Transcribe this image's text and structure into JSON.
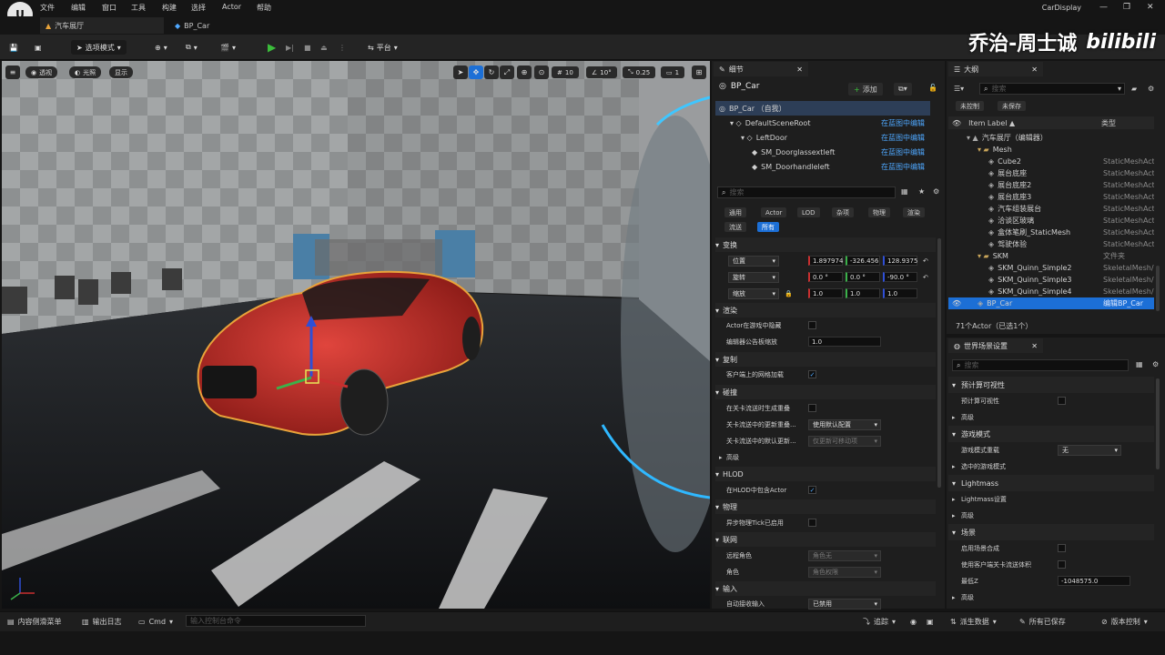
{
  "menu": [
    "文件",
    "编辑",
    "窗口",
    "工具",
    "构建",
    "选择",
    "Actor",
    "帮助"
  ],
  "window_title": "CarDisplay",
  "tabs": [
    "汽车展厅",
    "BP_Car"
  ],
  "toolbar": {
    "mode": "选项模式",
    "platform": "平台"
  },
  "watermark": "乔治-周士诚",
  "watermark_logo": "bilibili",
  "viewport": {
    "view_mode": "透视",
    "lighting": "光照",
    "show": "显示",
    "grid_snap": "10",
    "angle_snap": "10°",
    "scale_snap": "0.25",
    "cameras": "1"
  },
  "details": {
    "tab": "细节",
    "actor_name": "BP_Car",
    "add_label": "添加",
    "components": [
      {
        "label": "BP_Car （自我）",
        "link": "",
        "indent": 0
      },
      {
        "label": "DefaultSceneRoot",
        "link": "在蓝图中编辑",
        "indent": 1
      },
      {
        "label": "LeftDoor",
        "link": "在蓝图中编辑",
        "indent": 2
      },
      {
        "label": "SM_Doorglassextleft",
        "link": "在蓝图中编辑",
        "indent": 3
      },
      {
        "label": "SM_Doorhandleleft",
        "link": "在蓝图中编辑",
        "indent": 3
      }
    ],
    "search_placeholder": "搜索",
    "filters": [
      "通用",
      "Actor",
      "LOD",
      "杂项",
      "物理",
      "渲染",
      "流送",
      "所有"
    ],
    "sections": {
      "transform": "变换",
      "rendering": "渲染",
      "replication": "复制",
      "collision": "碰撞",
      "advanced": "高级",
      "hlod": "HLOD",
      "physics": "物理",
      "networking": "联网",
      "input": "输入"
    },
    "transform": {
      "location_label": "位置",
      "location": [
        "1.897974",
        "-326.456",
        "128.9375"
      ],
      "rotation_label": "旋转",
      "rotation": [
        "0.0 °",
        "0.0 °",
        "-90.0 °"
      ],
      "scale_label": "缩放",
      "scale": [
        "1.0",
        "1.0",
        "1.0"
      ]
    },
    "props": {
      "hidden_in_game": "Actor在游戏中隐藏",
      "billboard_scale": "编辑器公告板缩放",
      "billboard_scale_value": "1.0",
      "net_load_client": "客户端上的网格加载",
      "gen_overlap_level": "在关卡流送时生成重叠",
      "update_overlap_method": "关卡流送中的更新重叠...",
      "update_overlap_value": "使用默认配置",
      "default_update_overlap": "关卡流送中的默认更新...",
      "default_update_overlap_value": "仅更新可移动项",
      "include_in_hlod": "在HLOD中包含Actor",
      "async_physics_tick": "异步物理Tick已启用",
      "remote_role": "远程角色",
      "remote_role_value": "角色无",
      "role": "角色",
      "role_value": "角色权限",
      "auto_receive_input": "自动接收输入",
      "auto_receive_input_value": "已禁用"
    }
  },
  "outliner": {
    "tab": "大纲",
    "search_placeholder": "搜索",
    "unsaved_filter": "未控制",
    "unsaved": "未保存",
    "col_label": "Item Label ▲",
    "col_type": "类型",
    "rows": [
      {
        "label": "汽车展厅（编辑器）",
        "type": "",
        "indent": 1,
        "icon": "level-icon"
      },
      {
        "label": "Mesh",
        "type": "",
        "indent": 2,
        "icon": "folder-icon"
      },
      {
        "label": "Cube2",
        "type": "StaticMeshAct",
        "indent": 3,
        "icon": "mesh-icon"
      },
      {
        "label": "展台底座",
        "type": "StaticMeshAct",
        "indent": 3,
        "icon": "mesh-icon"
      },
      {
        "label": "展台底座2",
        "type": "StaticMeshAct",
        "indent": 3,
        "icon": "mesh-icon"
      },
      {
        "label": "展台底座3",
        "type": "StaticMeshAct",
        "indent": 3,
        "icon": "mesh-icon"
      },
      {
        "label": "汽车组装展台",
        "type": "StaticMeshAct",
        "indent": 3,
        "icon": "mesh-icon"
      },
      {
        "label": "洽谈区玻璃",
        "type": "StaticMeshAct",
        "indent": 3,
        "icon": "mesh-icon"
      },
      {
        "label": "盒体笔刷_StaticMesh",
        "type": "StaticMeshAct",
        "indent": 3,
        "icon": "mesh-icon"
      },
      {
        "label": "驾驶体验",
        "type": "StaticMeshAct",
        "indent": 3,
        "icon": "mesh-icon"
      },
      {
        "label": "SKM",
        "type": "文件夹",
        "indent": 2,
        "icon": "folder-icon"
      },
      {
        "label": "SKM_Quinn_Simple2",
        "type": "SkeletalMesh/",
        "indent": 3,
        "icon": "mesh-icon"
      },
      {
        "label": "SKM_Quinn_Simple3",
        "type": "SkeletalMesh/",
        "indent": 3,
        "icon": "mesh-icon"
      },
      {
        "label": "SKM_Quinn_Simple4",
        "type": "SkeletalMesh/",
        "indent": 3,
        "icon": "mesh-icon"
      },
      {
        "label": "BP_Car",
        "type": "编辑BP_Car",
        "indent": 2,
        "icon": "actor-icon",
        "selected": true
      }
    ],
    "count": "71个Actor（已选1个）"
  },
  "world_settings": {
    "tab": "世界场景设置",
    "search_placeholder": "搜索",
    "rows": [
      {
        "label": "预计算可视性",
        "kind": "section"
      },
      {
        "label": "预计算可视性",
        "kind": "check"
      },
      {
        "label": "高级",
        "kind": "sub"
      },
      {
        "label": "游戏模式",
        "kind": "section"
      },
      {
        "label": "游戏模式重载",
        "kind": "dropdown",
        "value": "无"
      },
      {
        "label": "选中的游戏模式",
        "kind": "sub"
      },
      {
        "label": "Lightmass",
        "kind": "section"
      },
      {
        "label": "Lightmass设置",
        "kind": "sub"
      },
      {
        "label": "高级",
        "kind": "sub"
      },
      {
        "label": "场景",
        "kind": "section"
      },
      {
        "label": "启用场景合成",
        "kind": "check"
      },
      {
        "label": "使用客户端关卡流送体积",
        "kind": "check"
      },
      {
        "label": "最低Z",
        "kind": "value",
        "value": "-1048575.0"
      },
      {
        "label": "高级",
        "kind": "sub"
      }
    ]
  },
  "statusbar": {
    "content_drawer": "内容侧滑菜单",
    "output_log": "输出日志",
    "cmd": "Cmd",
    "cmd_placeholder": "输入控制台命令",
    "trace": "追踪",
    "derived_data": "派生数据",
    "all_saved": "所有已保存",
    "source_control": "版本控制"
  },
  "colors": {
    "accent": "#1c6fd6",
    "selection": "#c07a1a",
    "link": "#4fa8ff"
  }
}
